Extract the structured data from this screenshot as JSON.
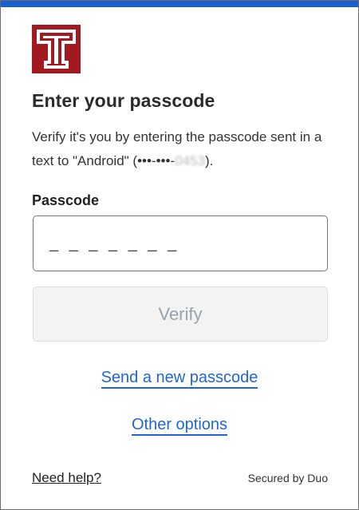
{
  "brand": {
    "logo_color": "#a2191f",
    "accent": "#1a5fd0"
  },
  "page": {
    "title": "Enter your passcode",
    "desc_prefix": "Verify it's you by entering the passcode sent in a text to \"Android\" (•••-•••-",
    "desc_masked": "0453",
    "desc_suffix": ")."
  },
  "form": {
    "passcode_label": "Passcode",
    "passcode_placeholder": "_ _ _ _ _ _ _",
    "passcode_value": "",
    "verify_label": "Verify"
  },
  "links": {
    "send_new": "Send a new passcode",
    "other_options": "Other options"
  },
  "footer": {
    "help": "Need help?",
    "secured": "Secured by Duo"
  }
}
